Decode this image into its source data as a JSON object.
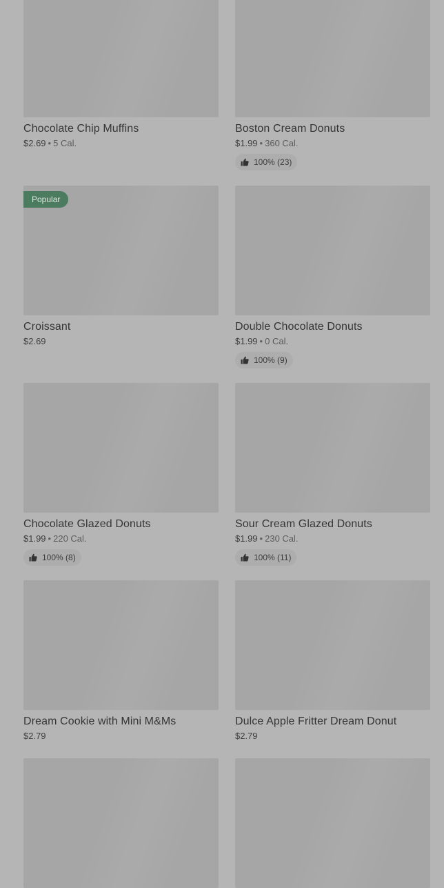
{
  "items": [
    {
      "name": "Chocolate Chip Muffins",
      "price": "$2.69",
      "cal": "5 Cal."
    },
    {
      "name": "Boston Cream Donuts",
      "price": "$1.99",
      "cal": "360 Cal.",
      "rating": "100% (23)"
    },
    {
      "name": "Croissant",
      "price": "$2.69",
      "badge": "Popular"
    },
    {
      "name": "Double Chocolate Donuts",
      "price": "$1.99",
      "cal": "0 Cal.",
      "rating": "100% (9)"
    },
    {
      "name": "Chocolate Glazed Donuts",
      "price": "$1.99",
      "cal": "220 Cal.",
      "rating": "100% (8)"
    },
    {
      "name": "Sour Cream Glazed Donuts",
      "price": "$1.99",
      "cal": "230 Cal.",
      "rating": "100% (11)"
    },
    {
      "name": "Dream Cookie with Mini M&Ms",
      "price": "$2.79"
    },
    {
      "name": "Dulce Apple Fritter Dream Donut",
      "price": "$2.79"
    }
  ],
  "separator": "•",
  "icons": {
    "rating": "thumbs-up-icon"
  }
}
